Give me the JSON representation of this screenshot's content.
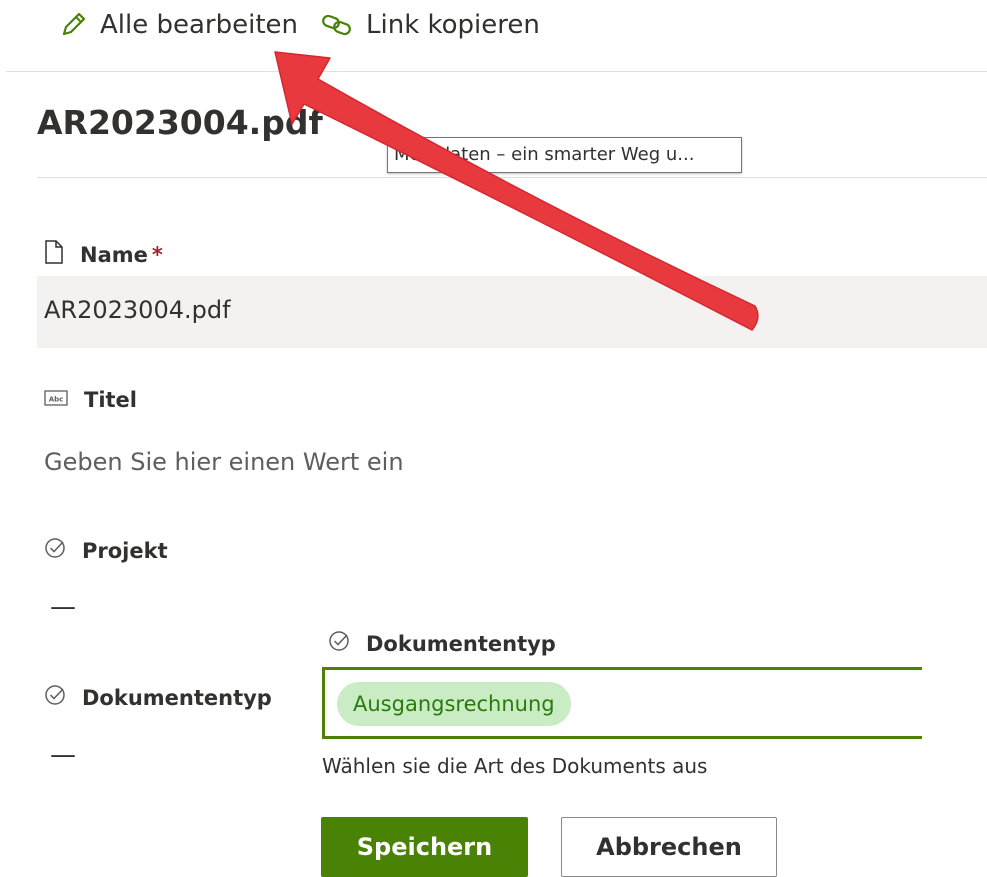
{
  "toolbar": {
    "edit_all": "Alle bearbeiten",
    "copy_link": "Link kopieren"
  },
  "file": {
    "title": "AR2023004.pdf"
  },
  "tooltip": {
    "text": "Metadaten – ein smarter Weg u..."
  },
  "fields": {
    "name": {
      "label": "Name",
      "required_mark": "*",
      "value": "AR2023004.pdf"
    },
    "titel": {
      "label": "Titel",
      "placeholder": "Geben Sie hier einen Wert ein"
    },
    "projekt": {
      "label": "Projekt",
      "value": "—"
    },
    "dokumententyp": {
      "label": "Dokumententyp",
      "value": "—"
    }
  },
  "editor": {
    "label": "Dokumententyp",
    "chip": "Ausgangsrechnung",
    "help": "Wählen sie die Art des Dokuments aus",
    "save": "Speichern",
    "cancel": "Abbrechen"
  },
  "colors": {
    "accent_green": "#498205",
    "chip_bg": "#c9ecc4",
    "annotation_arrow": "#e8393f"
  }
}
